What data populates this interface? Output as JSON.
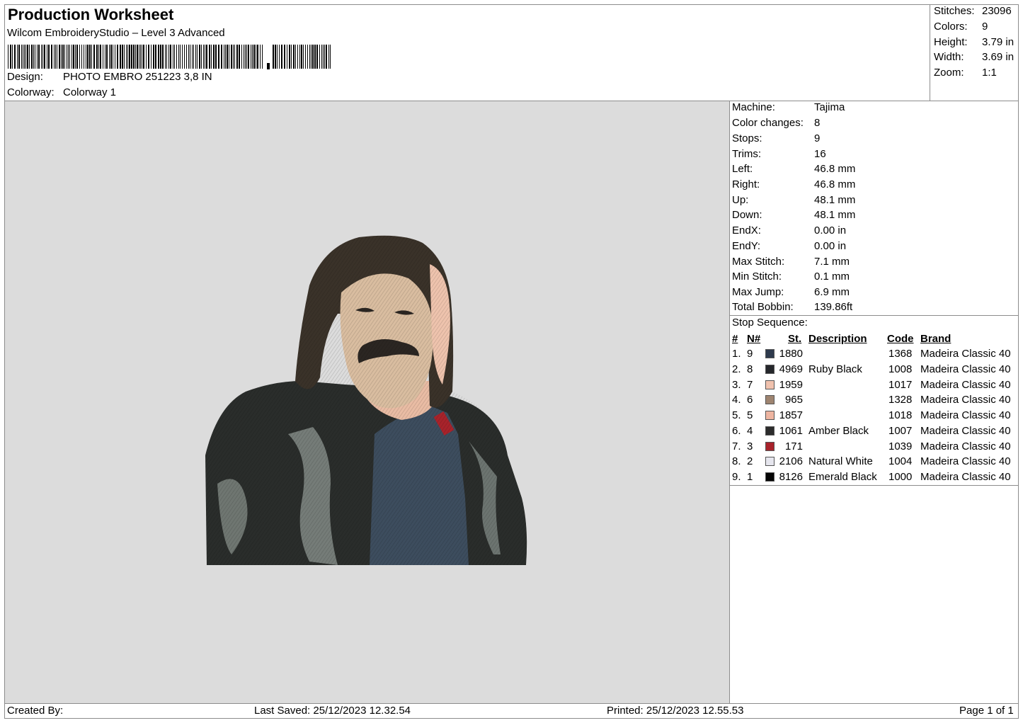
{
  "header": {
    "title": "Production Worksheet",
    "software": "Wilcom EmbroideryStudio – Level 3 Advanced",
    "design_label": "Design:",
    "design_value": "PHOTO EMBRO 251223 3,8 IN",
    "colorway_label": "Colorway:",
    "colorway_value": "Colorway 1"
  },
  "stats": [
    {
      "label": "Stitches:",
      "value": "23096"
    },
    {
      "label": "Colors:",
      "value": "9"
    },
    {
      "label": "Height:",
      "value": "3.79 in"
    },
    {
      "label": "Width:",
      "value": "3.69 in"
    },
    {
      "label": "Zoom:",
      "value": "1:1"
    }
  ],
  "machine_info": [
    {
      "label": "Machine:",
      "value": "Tajima"
    },
    {
      "label": "Color changes:",
      "value": "8"
    },
    {
      "label": "Stops:",
      "value": "9"
    },
    {
      "label": "Trims:",
      "value": "16"
    },
    {
      "label": "Left:",
      "value": "46.8 mm"
    },
    {
      "label": "Right:",
      "value": "46.8 mm"
    },
    {
      "label": "Up:",
      "value": "48.1 mm"
    },
    {
      "label": "Down:",
      "value": "48.1 mm"
    },
    {
      "label": "EndX:",
      "value": "0.00 in"
    },
    {
      "label": "EndY:",
      "value": "0.00 in"
    },
    {
      "label": "Max Stitch:",
      "value": "7.1 mm"
    },
    {
      "label": "Min Stitch:",
      "value": "0.1 mm"
    },
    {
      "label": "Max Jump:",
      "value": "6.9 mm"
    },
    {
      "label": "Total Bobbin:",
      "value": "139.86ft"
    }
  ],
  "stop_sequence": {
    "title": "Stop Sequence:",
    "headers": {
      "num": "#",
      "n": "N#",
      "st": "St.",
      "description": "Description",
      "code": "Code",
      "brand": "Brand"
    },
    "rows": [
      {
        "num": "1.",
        "n": "9",
        "color": "#2e3a4d",
        "st": "1880",
        "description": "",
        "code": "1368",
        "brand": "Madeira Classic 40"
      },
      {
        "num": "2.",
        "n": "8",
        "color": "#25272b",
        "st": "4969",
        "description": "Ruby Black",
        "code": "1008",
        "brand": "Madeira Classic 40"
      },
      {
        "num": "3.",
        "n": "7",
        "color": "#f0c2ae",
        "st": "1959",
        "description": "",
        "code": "1017",
        "brand": "Madeira Classic 40"
      },
      {
        "num": "4.",
        "n": "6",
        "color": "#9e8470",
        "st": "965",
        "description": "",
        "code": "1328",
        "brand": "Madeira Classic 40"
      },
      {
        "num": "5.",
        "n": "5",
        "color": "#eeb5a1",
        "st": "1857",
        "description": "",
        "code": "1018",
        "brand": "Madeira Classic 40"
      },
      {
        "num": "6.",
        "n": "4",
        "color": "#2c2c2c",
        "st": "1061",
        "description": "Amber Black",
        "code": "1007",
        "brand": "Madeira Classic 40"
      },
      {
        "num": "7.",
        "n": "3",
        "color": "#a8232b",
        "st": "171",
        "description": "",
        "code": "1039",
        "brand": "Madeira Classic 40"
      },
      {
        "num": "8.",
        "n": "2",
        "color": "#e6e6ee",
        "st": "2106",
        "description": "Natural White",
        "code": "1004",
        "brand": "Madeira Classic 40"
      },
      {
        "num": "9.",
        "n": "1",
        "color": "#050505",
        "st": "8126",
        "description": "Emerald Black",
        "code": "1000",
        "brand": "Madeira Classic 40"
      }
    ]
  },
  "footer": {
    "created_by": "Created By:",
    "last_saved": "Last Saved: 25/12/2023 12.32.54",
    "printed": "Printed: 25/12/2023 12.55.53",
    "page": "Page 1 of 1"
  }
}
